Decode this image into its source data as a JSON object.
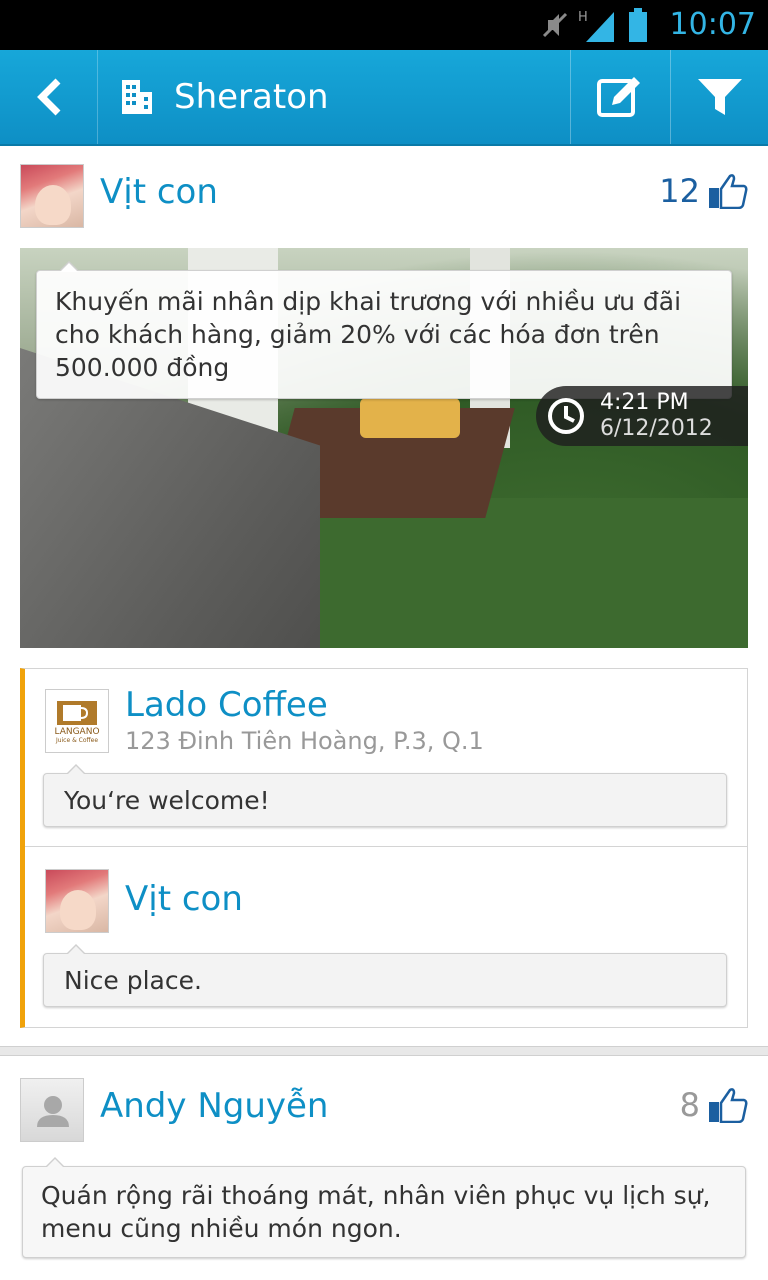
{
  "status_bar": {
    "time": "10:07",
    "icons": [
      "mute-icon",
      "signal-icon",
      "battery-icon"
    ],
    "network": "H"
  },
  "action_bar": {
    "title": "Sheraton",
    "back_icon": "back-chevron-icon",
    "title_icon": "building-icon",
    "edit_icon": "edit-icon",
    "filter_icon": "filter-icon"
  },
  "post1": {
    "user": "Vịt con",
    "likes": "12",
    "caption": "Khuyến mãi nhân dịp khai trương với nhiều ưu đãi cho khách hàng, giảm 20% với các hóa đơn trên 500.000 đồng",
    "time": "4:21 PM",
    "date": "6/12/2012",
    "comments": [
      {
        "name": "Lado Coffee",
        "address": "123 Đinh Tiên Hoàng, P.3, Q.1",
        "text": "You‘re welcome!",
        "logo_text": "LANGANO",
        "logo_sub": "Juice & Coffee"
      },
      {
        "name": "Vịt con",
        "text": "Nice place."
      }
    ]
  },
  "post2": {
    "user": "Andy Nguyễn",
    "likes": "8",
    "review": "Quán rộng rãi thoáng mát, nhân viên phục vụ lịch sự, menu cũng nhiều món ngon."
  },
  "colors": {
    "accent": "#0e8fc5",
    "status_time": "#33b5e5",
    "comment_bar": "#f0a20a",
    "like_count": "#1b5fa0"
  }
}
